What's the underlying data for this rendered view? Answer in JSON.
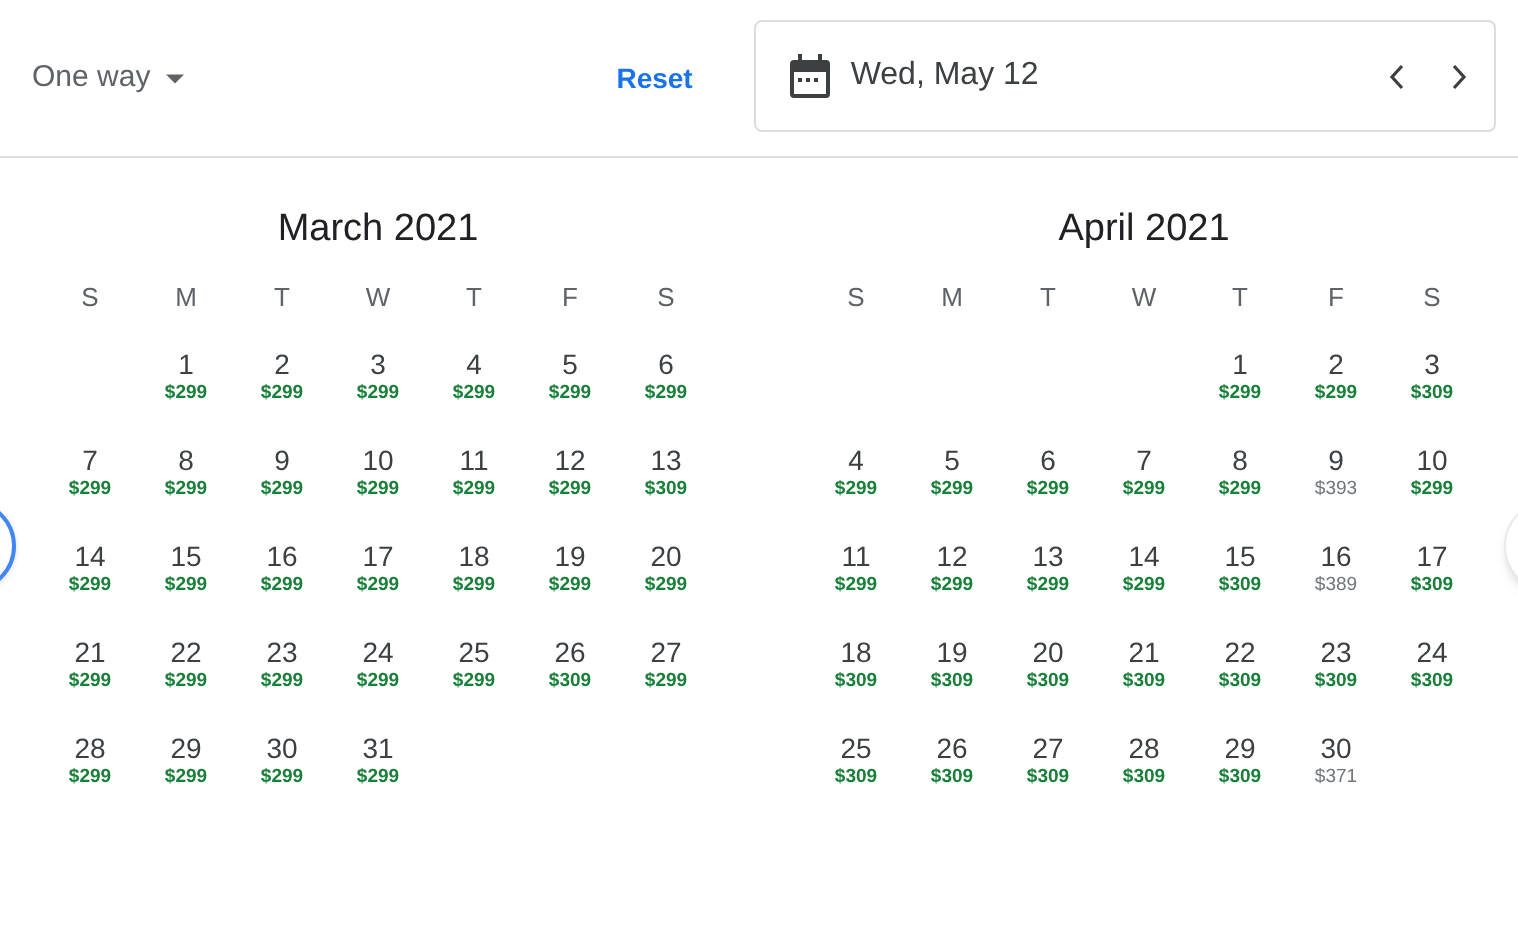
{
  "trip_type": {
    "label": "One way"
  },
  "reset": "Reset",
  "date_field": {
    "value": "Wed, May 12"
  },
  "months": [
    {
      "title": "March 2021",
      "weekdays": [
        "S",
        "M",
        "T",
        "W",
        "T",
        "F",
        "S"
      ],
      "weeks": [
        {
          "days": [
            {
              "day": "1",
              "price": "$299",
              "low": true
            },
            {
              "day": "2",
              "price": "$299",
              "low": true
            },
            {
              "day": "3",
              "price": "$299",
              "low": true
            },
            {
              "day": "4",
              "price": "$299",
              "low": true
            },
            {
              "day": "5",
              "price": "$299",
              "low": true
            },
            {
              "day": "6",
              "price": "$299",
              "low": true
            }
          ]
        },
        {
          "days": [
            {
              "day": "7",
              "price": "$299",
              "low": true
            },
            {
              "day": "8",
              "price": "$299",
              "low": true
            },
            {
              "day": "9",
              "price": "$299",
              "low": true
            },
            {
              "day": "10",
              "price": "$299",
              "low": true
            },
            {
              "day": "11",
              "price": "$299",
              "low": true
            },
            {
              "day": "12",
              "price": "$299",
              "low": true
            },
            {
              "day": "13",
              "price": "$309",
              "low": true
            }
          ]
        },
        {
          "days": [
            {
              "day": "14",
              "price": "$299",
              "low": true
            },
            {
              "day": "15",
              "price": "$299",
              "low": true
            },
            {
              "day": "16",
              "price": "$299",
              "low": true
            },
            {
              "day": "17",
              "price": "$299",
              "low": true
            },
            {
              "day": "18",
              "price": "$299",
              "low": true
            },
            {
              "day": "19",
              "price": "$299",
              "low": true
            },
            {
              "day": "20",
              "price": "$299",
              "low": true
            }
          ]
        },
        {
          "days": [
            {
              "day": "21",
              "price": "$299",
              "low": true
            },
            {
              "day": "22",
              "price": "$299",
              "low": true
            },
            {
              "day": "23",
              "price": "$299",
              "low": true
            },
            {
              "day": "24",
              "price": "$299",
              "low": true
            },
            {
              "day": "25",
              "price": "$299",
              "low": true
            },
            {
              "day": "26",
              "price": "$309",
              "low": true
            },
            {
              "day": "27",
              "price": "$299",
              "low": true
            }
          ]
        },
        {
          "days": [
            {
              "day": "28",
              "price": "$299",
              "low": true
            },
            {
              "day": "29",
              "price": "$299",
              "low": true
            },
            {
              "day": "30",
              "price": "$299",
              "low": true
            },
            {
              "day": "31",
              "price": "$299",
              "low": true
            }
          ]
        }
      ]
    },
    {
      "title": "April 2021",
      "weekdays": [
        "S",
        "M",
        "T",
        "W",
        "T",
        "F",
        "S"
      ],
      "weeks": [
        {
          "days": [
            {
              "day": "1",
              "price": "$299",
              "low": true
            },
            {
              "day": "2",
              "price": "$299",
              "low": true
            },
            {
              "day": "3",
              "price": "$309",
              "low": true
            }
          ]
        },
        {
          "days": [
            {
              "day": "4",
              "price": "$299",
              "low": true
            },
            {
              "day": "5",
              "price": "$299",
              "low": true
            },
            {
              "day": "6",
              "price": "$299",
              "low": true
            },
            {
              "day": "7",
              "price": "$299",
              "low": true
            },
            {
              "day": "8",
              "price": "$299",
              "low": true
            },
            {
              "day": "9",
              "price": "$393",
              "low": false
            },
            {
              "day": "10",
              "price": "$299",
              "low": true
            }
          ]
        },
        {
          "days": [
            {
              "day": "11",
              "price": "$299",
              "low": true
            },
            {
              "day": "12",
              "price": "$299",
              "low": true
            },
            {
              "day": "13",
              "price": "$299",
              "low": true
            },
            {
              "day": "14",
              "price": "$299",
              "low": true
            },
            {
              "day": "15",
              "price": "$309",
              "low": true
            },
            {
              "day": "16",
              "price": "$389",
              "low": false
            },
            {
              "day": "17",
              "price": "$309",
              "low": true
            }
          ]
        },
        {
          "days": [
            {
              "day": "18",
              "price": "$309",
              "low": true
            },
            {
              "day": "19",
              "price": "$309",
              "low": true
            },
            {
              "day": "20",
              "price": "$309",
              "low": true
            },
            {
              "day": "21",
              "price": "$309",
              "low": true
            },
            {
              "day": "22",
              "price": "$309",
              "low": true
            },
            {
              "day": "23",
              "price": "$309",
              "low": true
            },
            {
              "day": "24",
              "price": "$309",
              "low": true
            }
          ]
        },
        {
          "days": [
            {
              "day": "25",
              "price": "$309",
              "low": true
            },
            {
              "day": "26",
              "price": "$309",
              "low": true
            },
            {
              "day": "27",
              "price": "$309",
              "low": true
            },
            {
              "day": "28",
              "price": "$309",
              "low": true
            },
            {
              "day": "29",
              "price": "$309",
              "low": true
            },
            {
              "day": "30",
              "price": "$371",
              "low": false
            }
          ]
        }
      ]
    }
  ]
}
